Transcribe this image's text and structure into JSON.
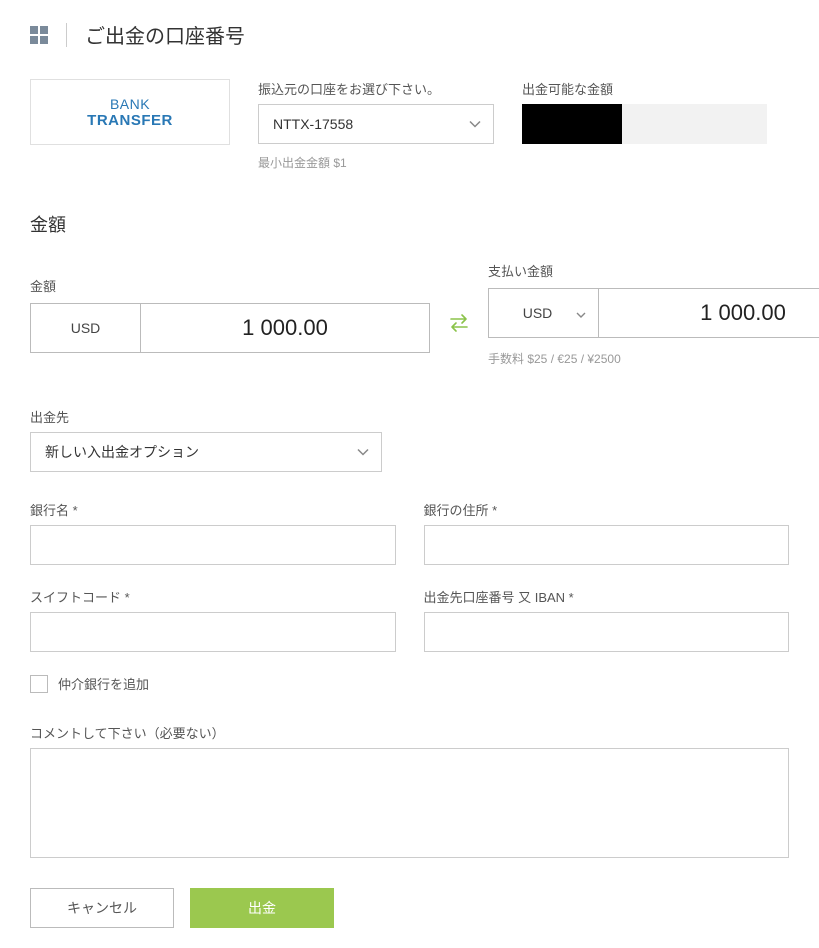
{
  "header": {
    "title": "ご出金の口座番号"
  },
  "bank_card": {
    "line1": "BANK",
    "line2": "TRANSFER"
  },
  "source_account": {
    "label": "振込元の口座をお選び下さい。",
    "value": "NTTX-17558",
    "helper": "最小出金金額 $1"
  },
  "available": {
    "label": "出金可能な金額"
  },
  "amount_section": {
    "title": "金額",
    "from": {
      "label": "金額",
      "currency": "USD",
      "value": "1 000.00"
    },
    "to": {
      "label": "支払い金額",
      "currency": "USD",
      "value": "1 000.00",
      "fee_text": "手数料 $25 / €25 / ¥2500"
    }
  },
  "destination": {
    "label": "出金先",
    "value": "新しい入出金オプション"
  },
  "bank_name": {
    "label": "銀行名 *"
  },
  "bank_address": {
    "label": "銀行の住所 *"
  },
  "swift": {
    "label": "スイフトコード *"
  },
  "dest_account": {
    "label": "出金先口座番号 又 IBAN *"
  },
  "intermediary": {
    "label": "仲介銀行を追加"
  },
  "comment": {
    "label": "コメントして下さい（必要ない）"
  },
  "buttons": {
    "cancel": "キャンセル",
    "submit": "出金"
  }
}
